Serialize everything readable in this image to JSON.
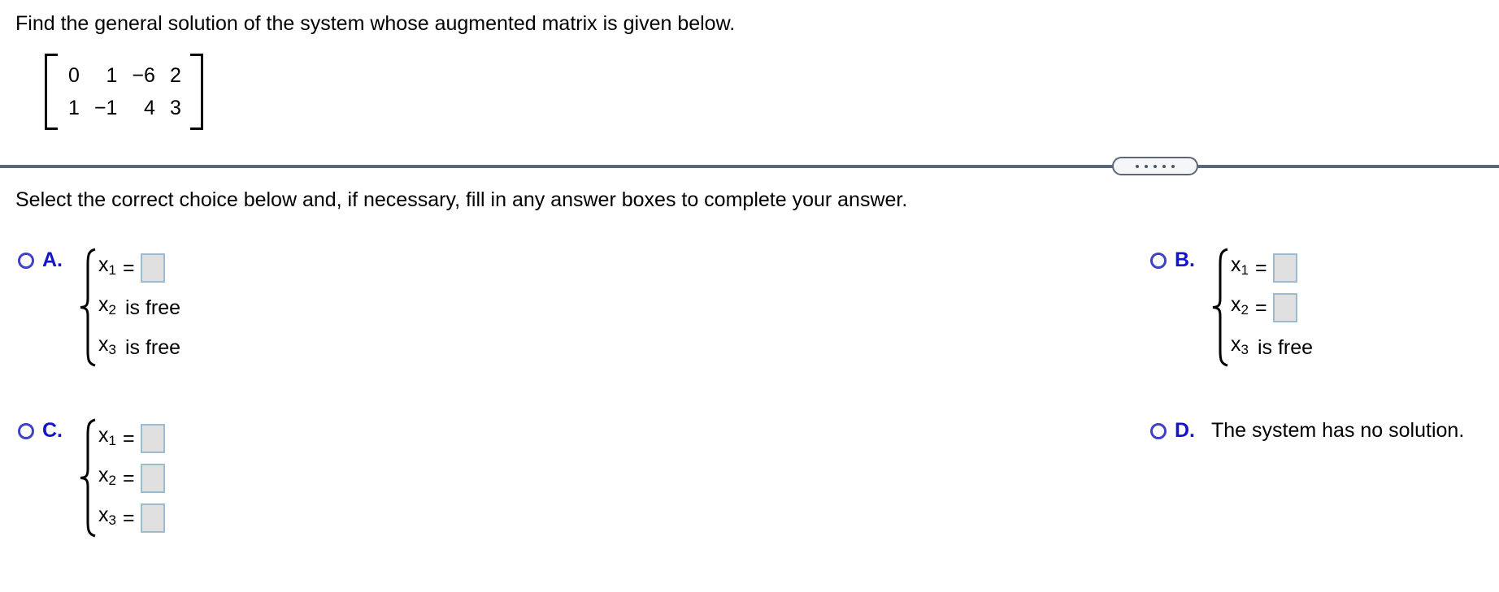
{
  "prompt": "Find the general solution of the system whose augmented matrix is given below.",
  "matrix": {
    "rows": [
      [
        "0",
        "1",
        "−6",
        "2"
      ],
      [
        "1",
        "−1",
        "4",
        "3"
      ]
    ]
  },
  "divider": {
    "handle_dots": 5,
    "line_color": "#5c6878"
  },
  "instruction": "Select the correct choice below and, if necessary, fill in any answer boxes to complete your answer.",
  "colors": {
    "choice_letter": "#1414c8",
    "radio_border": "#4040c8",
    "answer_box_fill": "#e0e0e0",
    "answer_box_border": "#9cbbd0",
    "divider": "#5c6878"
  },
  "choices": [
    {
      "id": "A",
      "letter": "A.",
      "type": "brace",
      "rows": [
        {
          "var": "x",
          "sub": "1",
          "op": "=",
          "kind": "input",
          "value": ""
        },
        {
          "var": "x",
          "sub": "2",
          "kind": "free",
          "text": "is free"
        },
        {
          "var": "x",
          "sub": "3",
          "kind": "free",
          "text": "is free"
        }
      ]
    },
    {
      "id": "B",
      "letter": "B.",
      "type": "brace",
      "rows": [
        {
          "var": "x",
          "sub": "1",
          "op": "=",
          "kind": "input",
          "value": ""
        },
        {
          "var": "x",
          "sub": "2",
          "op": "=",
          "kind": "input",
          "value": ""
        },
        {
          "var": "x",
          "sub": "3",
          "kind": "free",
          "text": "is free"
        }
      ]
    },
    {
      "id": "C",
      "letter": "C.",
      "type": "brace",
      "rows": [
        {
          "var": "x",
          "sub": "1",
          "op": "=",
          "kind": "input",
          "value": ""
        },
        {
          "var": "x",
          "sub": "2",
          "op": "=",
          "kind": "input",
          "value": ""
        },
        {
          "var": "x",
          "sub": "3",
          "op": "=",
          "kind": "input",
          "value": ""
        }
      ]
    },
    {
      "id": "D",
      "letter": "D.",
      "type": "text",
      "text": "The system has no solution."
    }
  ]
}
